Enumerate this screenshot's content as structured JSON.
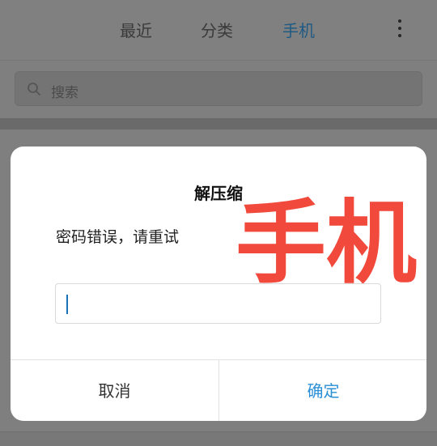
{
  "tabs": {
    "recent": "最近",
    "category": "分类",
    "phone": "手机"
  },
  "search": {
    "placeholder": "搜索"
  },
  "dialog": {
    "title": "解压缩",
    "message": "密码错误，请重试",
    "watermark_text": "手机",
    "password_value": "",
    "cancel_label": "取消",
    "confirm_label": "确定"
  },
  "colors": {
    "accent": "#2b8fd6",
    "watermark": "#f1493b"
  },
  "icons": [
    "more-vertical-icon",
    "search-icon"
  ]
}
